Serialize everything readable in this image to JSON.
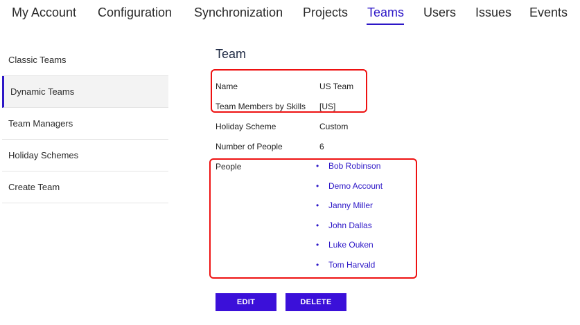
{
  "nav": {
    "tabs": [
      "My Account",
      "Configuration",
      "Synchronization",
      "Projects",
      "Teams",
      "Users",
      "Issues",
      "Events"
    ],
    "active": "Teams"
  },
  "sidebar": {
    "items": [
      "Classic Teams",
      "Dynamic Teams",
      "Team Managers",
      "Holiday Schemes",
      "Create Team"
    ],
    "active": "Dynamic Teams"
  },
  "team": {
    "title": "Team",
    "fields": [
      {
        "label": "Name",
        "value": "US Team"
      },
      {
        "label": "Team Members by Skills",
        "value": "[US]"
      },
      {
        "label": "Holiday Scheme",
        "value": "Custom"
      },
      {
        "label": "Number of People",
        "value": "6"
      }
    ],
    "people_label": "People",
    "people": [
      "Bob Robinson",
      "Demo Account",
      "Janny Miller",
      "John Dallas",
      "Luke Ouken",
      "Tom Harvald"
    ]
  },
  "actions": {
    "edit": "EDIT",
    "delete": "DELETE"
  },
  "colors": {
    "accent": "#2d17c7",
    "button": "#3b10d9",
    "highlight": "#ee1111"
  }
}
